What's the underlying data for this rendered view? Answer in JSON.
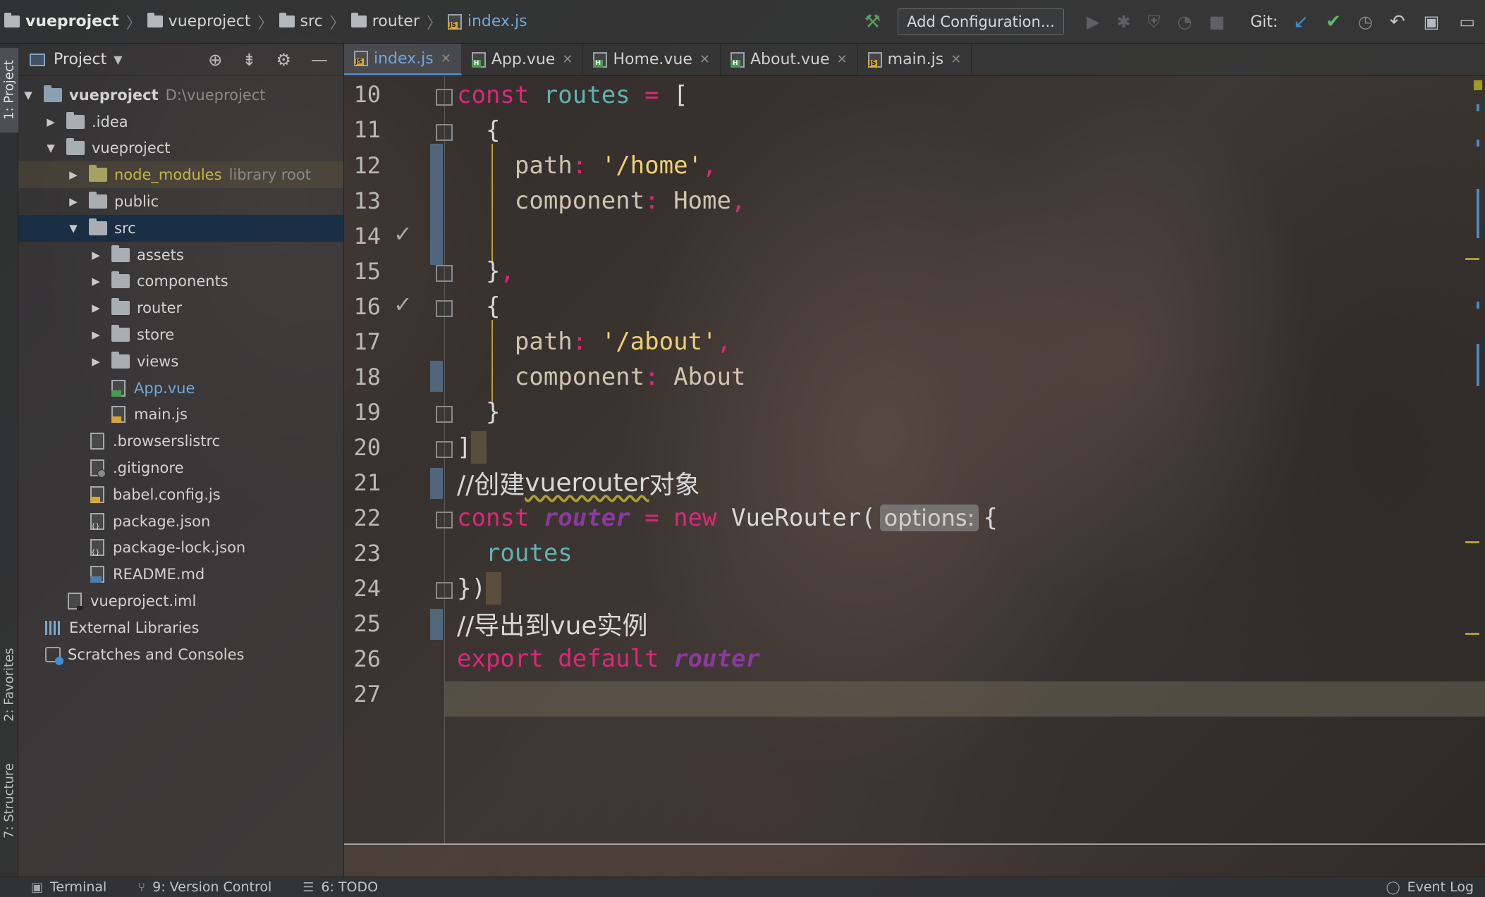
{
  "breadcrumb": {
    "items": [
      "vueproject",
      "vueproject",
      "src",
      "router",
      "index.js"
    ]
  },
  "toolbar": {
    "add_configuration": "Add Configuration...",
    "git_label": "Git:"
  },
  "left_strip": {
    "project_tab": "1: Project",
    "favorites_tab": "2: Favorites",
    "structure_tab": "7: Structure"
  },
  "project_panel": {
    "title": "Project",
    "tree": {
      "root_name": "vueproject",
      "root_path": "D:\\vueproject",
      "idea": ".idea",
      "vueproject_dir": "vueproject",
      "node_modules": "node_modules",
      "library_root": "library root",
      "public": "public",
      "src": "src",
      "assets": "assets",
      "components": "components",
      "router": "router",
      "store": "store",
      "views": "views",
      "app_vue": "App.vue",
      "main_js": "main.js",
      "browserslistrc": ".browserslistrc",
      "gitignore": ".gitignore",
      "babel_config": "babel.config.js",
      "package_json": "package.json",
      "package_lock": "package-lock.json",
      "readme": "README.md",
      "iml": "vueproject.iml",
      "external_libraries": "External Libraries",
      "scratches": "Scratches and Consoles"
    }
  },
  "tabs": [
    {
      "label": "index.js",
      "active": true
    },
    {
      "label": "App.vue",
      "active": false
    },
    {
      "label": "Home.vue",
      "active": false
    },
    {
      "label": "About.vue",
      "active": false
    },
    {
      "label": "main.js",
      "active": false
    }
  ],
  "editor": {
    "line_numbers": [
      "10",
      "11",
      "12",
      "13",
      "14",
      "15",
      "16",
      "17",
      "18",
      "19",
      "20",
      "21",
      "22",
      "23",
      "24",
      "25",
      "26",
      "27"
    ],
    "code": {
      "l10_const": "const",
      "l10_routes": " routes ",
      "l10_eq": "=",
      "l10_bracket": " [",
      "l11": "  {",
      "l12_key": "    path",
      "l12_colon": ": ",
      "l12_val": "'/home'",
      "l12_comma": ",",
      "l13_key": "    component",
      "l13_colon": ": ",
      "l13_val": "Home",
      "l13_comma": ",",
      "l15_brace": "  }",
      "l15_comma": ",",
      "l16": "  {",
      "l17_key": "    path",
      "l17_colon": ": ",
      "l17_val": "'/about'",
      "l17_comma": ",",
      "l18_key": "    component",
      "l18_colon": ": ",
      "l18_val": "About",
      "l19": "  }",
      "l20": "]",
      "l21_a": "//创建",
      "l21_b": "vuerouter",
      "l21_c": "对象",
      "l22_const": "const",
      "l22_router": " router ",
      "l22_eq": "=",
      "l22_new": " new",
      "l22_cls": " VueRouter(",
      "l22_hint": "options:",
      "l22_brace": "{",
      "l23": "  routes",
      "l24": "})",
      "l25": "//导出到vue实例",
      "l26_export": "export",
      "l26_default": " default",
      "l26_router": " router"
    }
  },
  "statusbar": {
    "terminal": "Terminal",
    "version_control": "9: Version Control",
    "todo": "6: TODO",
    "event_log": "Event Log"
  },
  "colors": {
    "keyword": "#e0267a",
    "string": "#f0d070",
    "variable": "#5fb3b3",
    "accent_blue": "#6fa8dc"
  }
}
